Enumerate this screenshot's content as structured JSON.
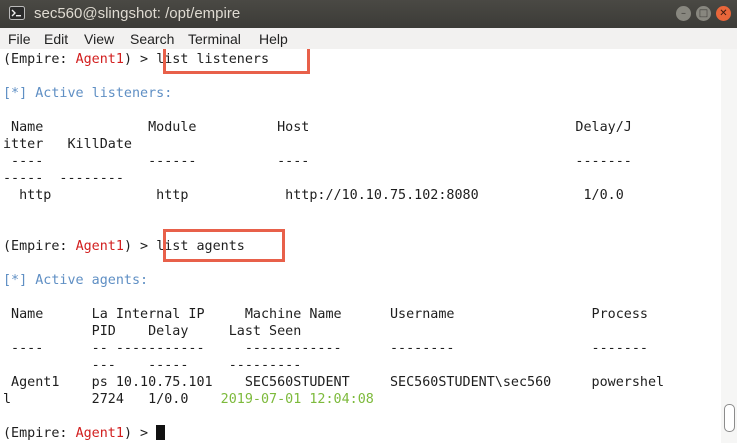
{
  "window": {
    "title": "sec560@slingshot: /opt/empire",
    "controls": [
      "minimize",
      "maximize",
      "close"
    ]
  },
  "menu": [
    "File",
    "Edit",
    "View",
    "Search",
    "Terminal",
    "Help"
  ],
  "prompt": {
    "open": "(Empire: ",
    "agent": "Agent1",
    "close": ") > "
  },
  "commands": [
    "list listeners",
    "list agents"
  ],
  "listeners_section": {
    "heading": "[*] Active listeners:",
    "header1": " Name             Module          Host                                 Delay/J",
    "header2": "itter   KillDate",
    "dash1": " ----             ------          ----                                 -------",
    "dash2": "-----  --------",
    "row": "  http             http            http://10.10.75.102:8080             1/0.0"
  },
  "agents_section": {
    "heading": "[*] Active agents:",
    "header1": " Name      La Internal IP     Machine Name      Username                 Process",
    "header2": "           PID    Delay     Last Seen",
    "dash1": " ----      -- -----------     ------------      --------                 -------",
    "dash2": "           ---    -----     ---------",
    "row1": " Agent1    ps 10.10.75.101    SEC560STUDENT     SEC560STUDENT\\sec560     powershel",
    "row2_lead": "l          2724   1/0.0    ",
    "row2_last_seen": "2019-07-01 12:04:08"
  },
  "colors": {
    "agent_name": "#d21e1e",
    "info_heading": "#5f8fc4",
    "last_seen": "#7dba3c",
    "highlight_box": "#e8604a",
    "titlebar": "#3c3b37",
    "close_button": "#e9663a"
  }
}
